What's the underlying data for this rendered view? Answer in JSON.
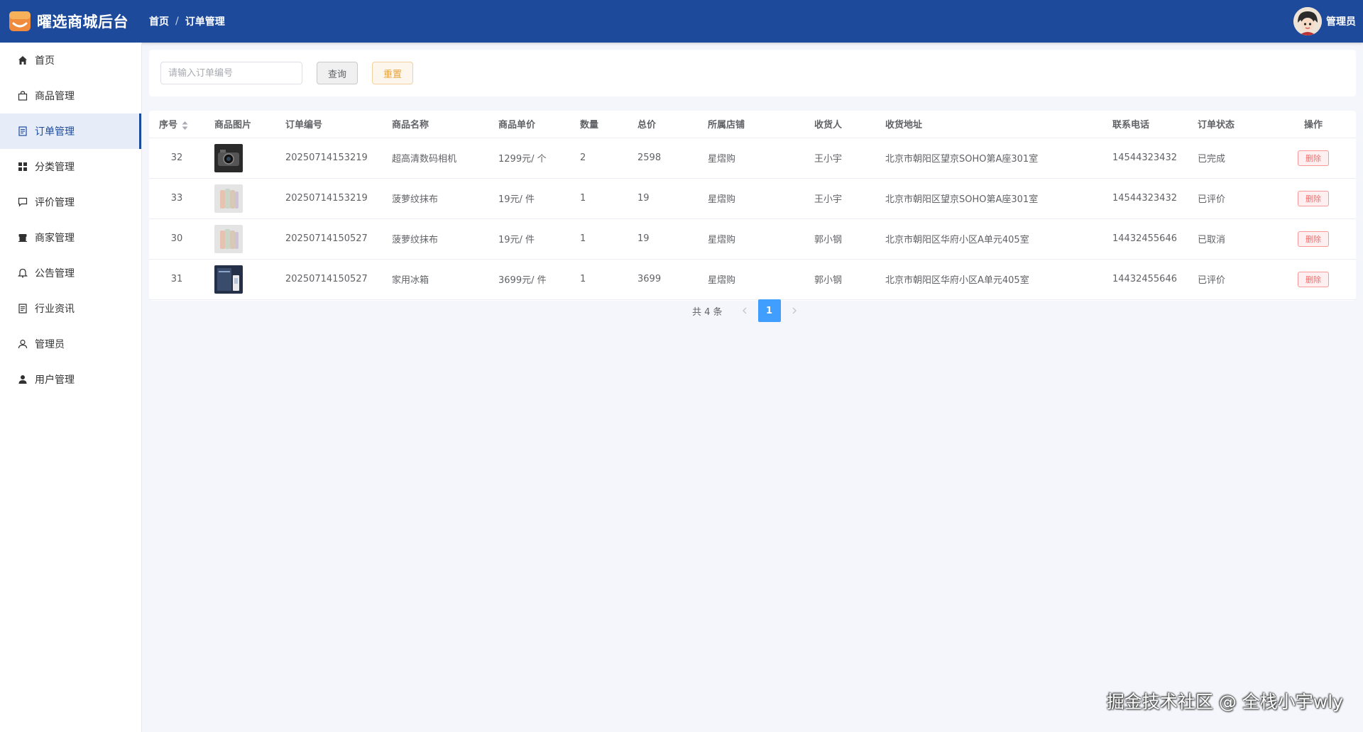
{
  "app": {
    "title": "曜选商城后台"
  },
  "breadcrumb": {
    "home": "首页",
    "separator": "/",
    "current": "订单管理"
  },
  "user": {
    "name": "管理员"
  },
  "sidebar": {
    "items": [
      {
        "label": "首页",
        "icon": "home-icon"
      },
      {
        "label": "商品管理",
        "icon": "shopping-bag-icon"
      },
      {
        "label": "订单管理",
        "icon": "document-icon",
        "active": true
      },
      {
        "label": "分类管理",
        "icon": "grid-icon"
      },
      {
        "label": "评价管理",
        "icon": "comment-icon"
      },
      {
        "label": "商家管理",
        "icon": "shop-icon"
      },
      {
        "label": "公告管理",
        "icon": "bell-icon"
      },
      {
        "label": "行业资讯",
        "icon": "document-icon"
      },
      {
        "label": "管理员",
        "icon": "user-outline-icon"
      },
      {
        "label": "用户管理",
        "icon": "user-filled-icon"
      }
    ]
  },
  "search": {
    "placeholder": "请输入订单编号",
    "value": "",
    "query_label": "查询",
    "reset_label": "重置"
  },
  "table": {
    "headers": {
      "index": "序号",
      "image": "商品图片",
      "order_no": "订单编号",
      "name": "商品名称",
      "unit_price": "商品单价",
      "qty": "数量",
      "total": "总价",
      "store": "所属店铺",
      "receiver": "收货人",
      "address": "收货地址",
      "phone": "联系电话",
      "status": "订单状态",
      "action": "操作"
    },
    "rows": [
      {
        "index": "32",
        "image": "camera-thumbnail",
        "order_no": "20250714153219",
        "name": "超高清数码相机",
        "unit_price": "1299元/ 个",
        "qty": "2",
        "total": "2598",
        "store": "星熠购",
        "receiver": "王小宇",
        "address": "北京市朝阳区望京SOHO第A座301室",
        "phone": "14544323432",
        "status": "已完成",
        "action": "删除"
      },
      {
        "index": "33",
        "image": "towel-thumbnail",
        "order_no": "20250714153219",
        "name": "菠萝纹抹布",
        "unit_price": "19元/ 件",
        "qty": "1",
        "total": "19",
        "store": "星熠购",
        "receiver": "王小宇",
        "address": "北京市朝阳区望京SOHO第A座301室",
        "phone": "14544323432",
        "status": "已评价",
        "action": "删除"
      },
      {
        "index": "30",
        "image": "towel-thumbnail",
        "order_no": "20250714150527",
        "name": "菠萝纹抹布",
        "unit_price": "19元/ 件",
        "qty": "1",
        "total": "19",
        "store": "星熠购",
        "receiver": "郭小钢",
        "address": "北京市朝阳区华府小区A单元405室",
        "phone": "14432455646",
        "status": "已取消",
        "action": "删除"
      },
      {
        "index": "31",
        "image": "fridge-thumbnail",
        "order_no": "20250714150527",
        "name": "家用冰箱",
        "unit_price": "3699元/ 件",
        "qty": "1",
        "total": "3699",
        "store": "星熠购",
        "receiver": "郭小钢",
        "address": "北京市朝阳区华府小区A单元405室",
        "phone": "14432455646",
        "status": "已评价",
        "action": "删除"
      }
    ]
  },
  "pagination": {
    "total_text": "共 4 条",
    "current_page": "1"
  },
  "watermark": "掘金技术社区 @ 全栈小宇wly",
  "colors": {
    "header_bg": "#1d4a9b",
    "page_bg": "#f4f6fb",
    "active_menu_bg": "#e6edf9",
    "primary": "#409eff",
    "reset_btn": "#e6a23c",
    "danger": "#f56c6c"
  }
}
